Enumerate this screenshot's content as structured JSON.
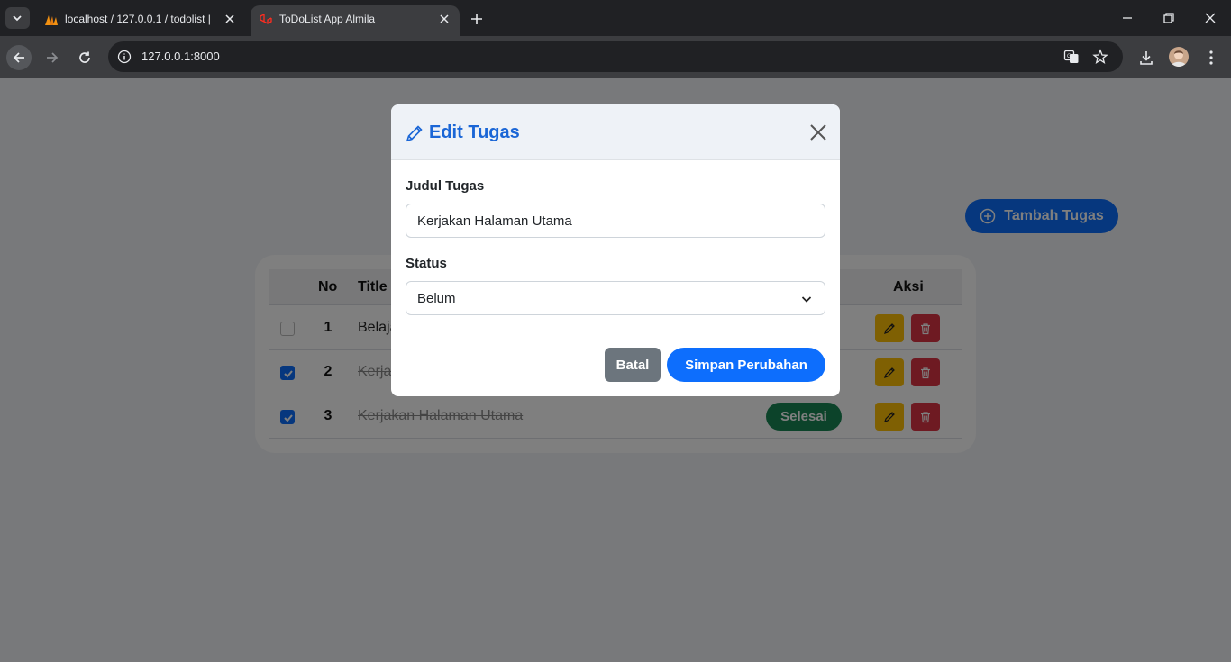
{
  "browser": {
    "tabs": [
      {
        "title": "localhost / 127.0.0.1 / todolist |"
      },
      {
        "title": "ToDoList App Almila"
      }
    ],
    "url": "127.0.0.1:8000"
  },
  "page": {
    "add_button": "Tambah Tugas",
    "table": {
      "headers": {
        "no": "No",
        "title": "Title",
        "aksi": "Aksi"
      },
      "rows": [
        {
          "no": "1",
          "title": "Belaja",
          "done": false,
          "status": ""
        },
        {
          "no": "2",
          "title": "Kerja",
          "done": true,
          "status": ""
        },
        {
          "no": "3",
          "title": "Kerjakan Halaman Utama",
          "done": true,
          "status": "Selesai"
        }
      ]
    }
  },
  "modal": {
    "title": "Edit Tugas",
    "judul_label": "Judul Tugas",
    "judul_value": "Kerjakan Halaman Utama",
    "status_label": "Status",
    "status_value": "Belum",
    "cancel_label": "Batal",
    "save_label": "Simpan Perubahan"
  },
  "colors": {
    "primary": "#0d6efd",
    "success": "#198754",
    "warning": "#ffc107",
    "danger": "#dc3545",
    "secondary": "#6c757d"
  }
}
